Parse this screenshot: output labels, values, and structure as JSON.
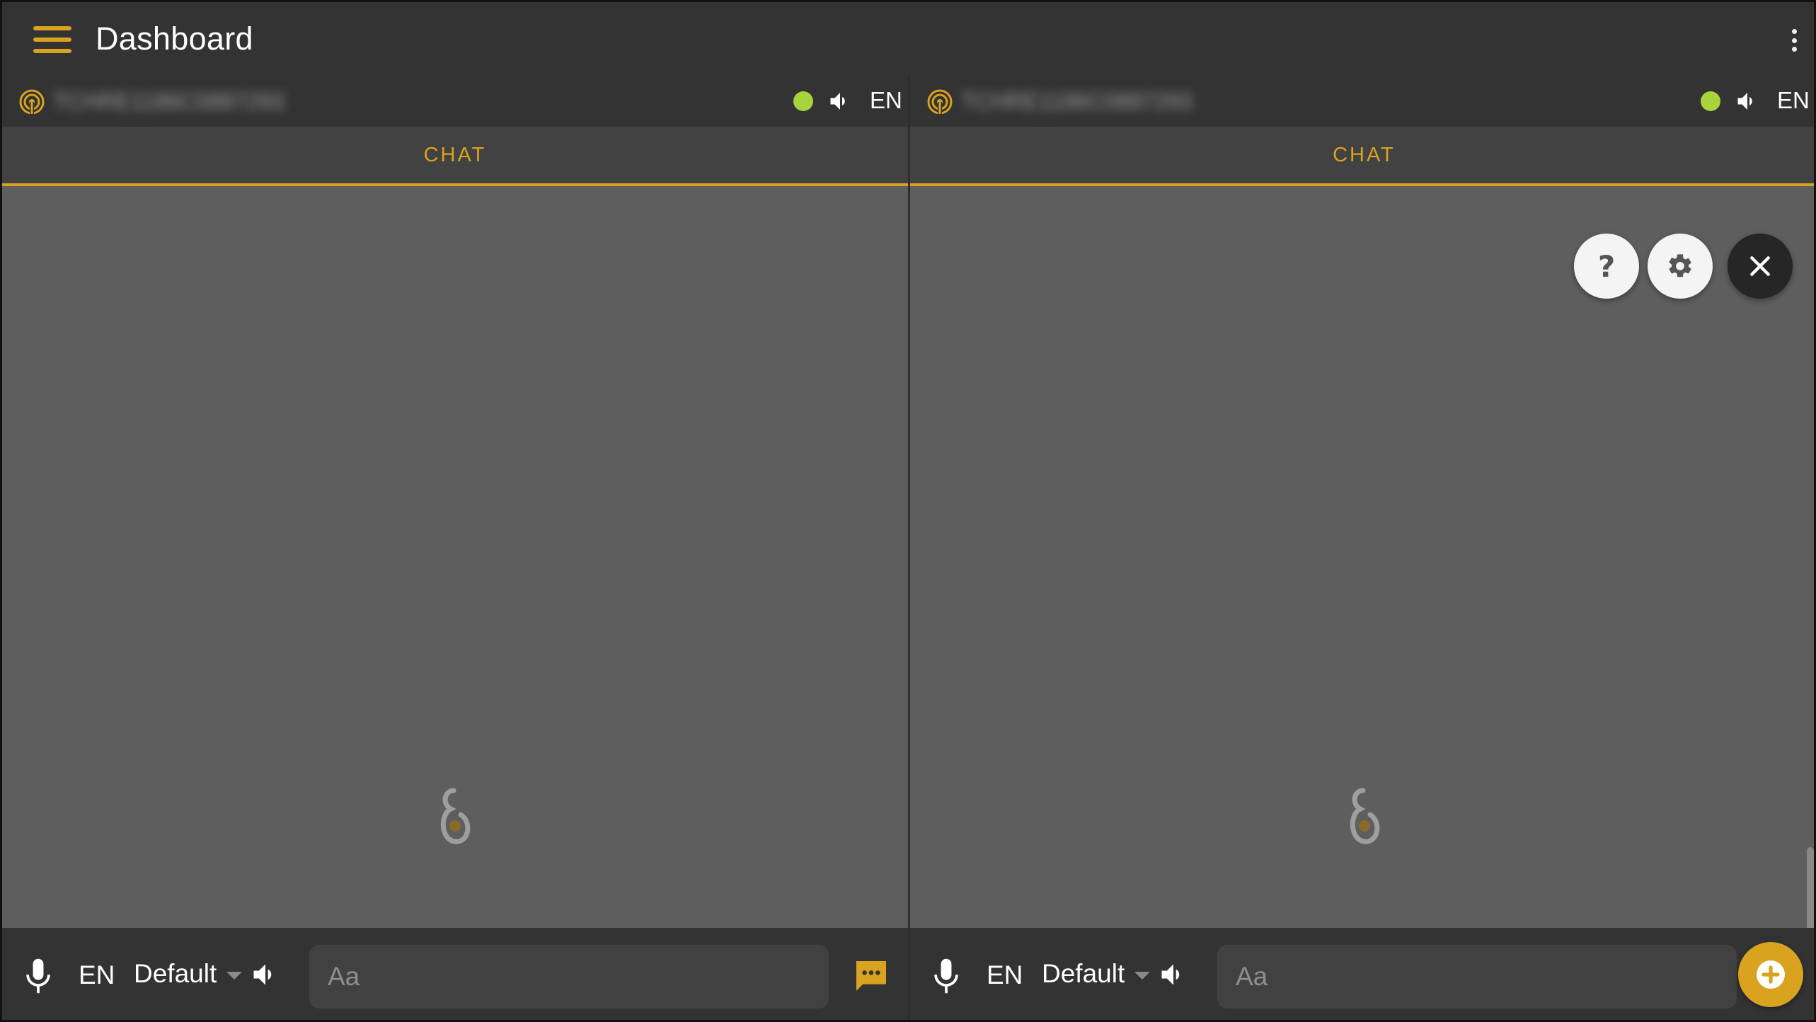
{
  "app": {
    "title": "Dashboard"
  },
  "theme": {
    "accent": "#d9a21f",
    "status_online": "#a8d33c",
    "bar_bg": "#333333",
    "content_bg": "#5e5e5e"
  },
  "panels": [
    {
      "device_name": "TCHRE1186C0887293",
      "status": "online",
      "top_language": "EN",
      "tab_label": "CHAT",
      "input": {
        "language": "EN",
        "voice": "Default",
        "placeholder": "Aa",
        "value": ""
      }
    },
    {
      "device_name": "TCHRE1186C0887293",
      "status": "online",
      "top_language": "EN",
      "tab_label": "CHAT",
      "input": {
        "language": "EN",
        "voice": "Default",
        "placeholder": "Aa",
        "value": ""
      }
    }
  ],
  "icons": {
    "menu": "hamburger-menu-icon",
    "more": "more-vert-icon",
    "broadcast": "broadcast-icon",
    "speaker": "volume-icon",
    "mic": "microphone-icon",
    "chat": "chat-bubble-icon",
    "help": "help-icon",
    "settings": "gear-icon",
    "close": "close-icon",
    "add": "add-icon"
  },
  "floating_actions": {
    "help_glyph": "?"
  }
}
